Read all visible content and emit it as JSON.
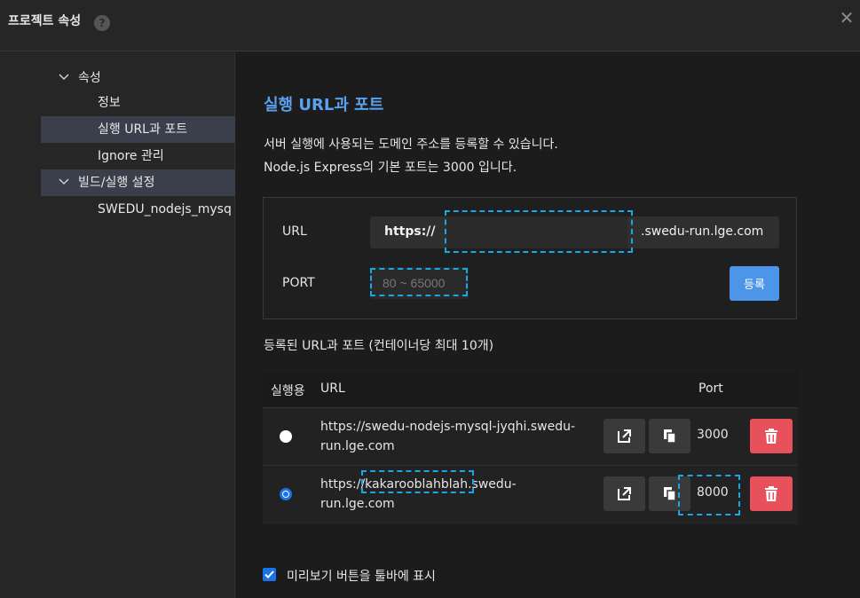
{
  "dialog": {
    "title": "프로젝트 속성",
    "help_icon": "?",
    "close_icon": "✕"
  },
  "sidebar": {
    "items": [
      {
        "label": "속성",
        "expanded": true
      },
      {
        "label": "정보"
      },
      {
        "label": "실행 URL과 포트",
        "selected": true
      },
      {
        "label": "Ignore 관리"
      },
      {
        "label": "빌드/실행 설정",
        "expanded": true
      },
      {
        "label": "SWEDU_nodejs_mysq"
      }
    ]
  },
  "main": {
    "heading": "실행 URL과 포트",
    "desc_line1": "서버 실행에 사용되는 도메인 주소를 등록할 수 있습니다.",
    "desc_line2": "Node.js Express의 기본 포트는 3000 입니다.",
    "form": {
      "url_label": "URL",
      "url_prefix": "https://",
      "url_value": "",
      "url_suffix": ".swedu-run.lge.com",
      "port_label": "PORT",
      "port_placeholder": "80 ~ 65000",
      "register_button": "등록"
    },
    "registered_label": "등록된 URL과 포트 (컨테이너당 최대 10개)",
    "table": {
      "headers": {
        "run": "실행용",
        "url": "URL",
        "port": "Port"
      },
      "rows": [
        {
          "url": "https://swedu-nodejs-mysql-jyqhi.swedu-run.lge.com",
          "port": "3000",
          "active": false
        },
        {
          "url": "https://kakarooblahblah.swedu-run.lge.com",
          "port": "8000",
          "active": true
        }
      ]
    },
    "preview_checkbox": {
      "label": "미리보기 버튼을 툴바에 표시",
      "checked": true
    }
  },
  "colors": {
    "accent": "#5aa2f0",
    "button": "#4d95e8",
    "danger": "#e8505b",
    "highlight": "#1aa7e8"
  }
}
